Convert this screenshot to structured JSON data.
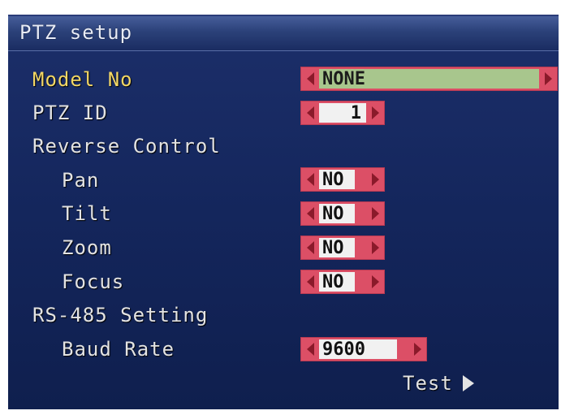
{
  "title": "PTZ setup",
  "rows": {
    "model_no": {
      "label": "Model No",
      "value": "NONE"
    },
    "ptz_id": {
      "label": "PTZ ID",
      "value": "1"
    },
    "reverse_control": {
      "label": "Reverse Control"
    },
    "pan": {
      "label": "Pan",
      "value": "NO"
    },
    "tilt": {
      "label": "Tilt",
      "value": "NO"
    },
    "zoom": {
      "label": "Zoom",
      "value": "NO"
    },
    "focus": {
      "label": "Focus",
      "value": "NO"
    },
    "rs485": {
      "label": "RS-485 Setting"
    },
    "baud_rate": {
      "label": "Baud Rate",
      "value": "9600"
    }
  },
  "test_label": "Test",
  "icons": {
    "left": "chevron-left-icon",
    "right": "chevron-right-icon",
    "test": "play-icon"
  },
  "colors": {
    "panel": "#14265c",
    "highlight_text": "#f3d765",
    "field": "#dc4f66",
    "model_value_bg": "#a8c68d"
  }
}
